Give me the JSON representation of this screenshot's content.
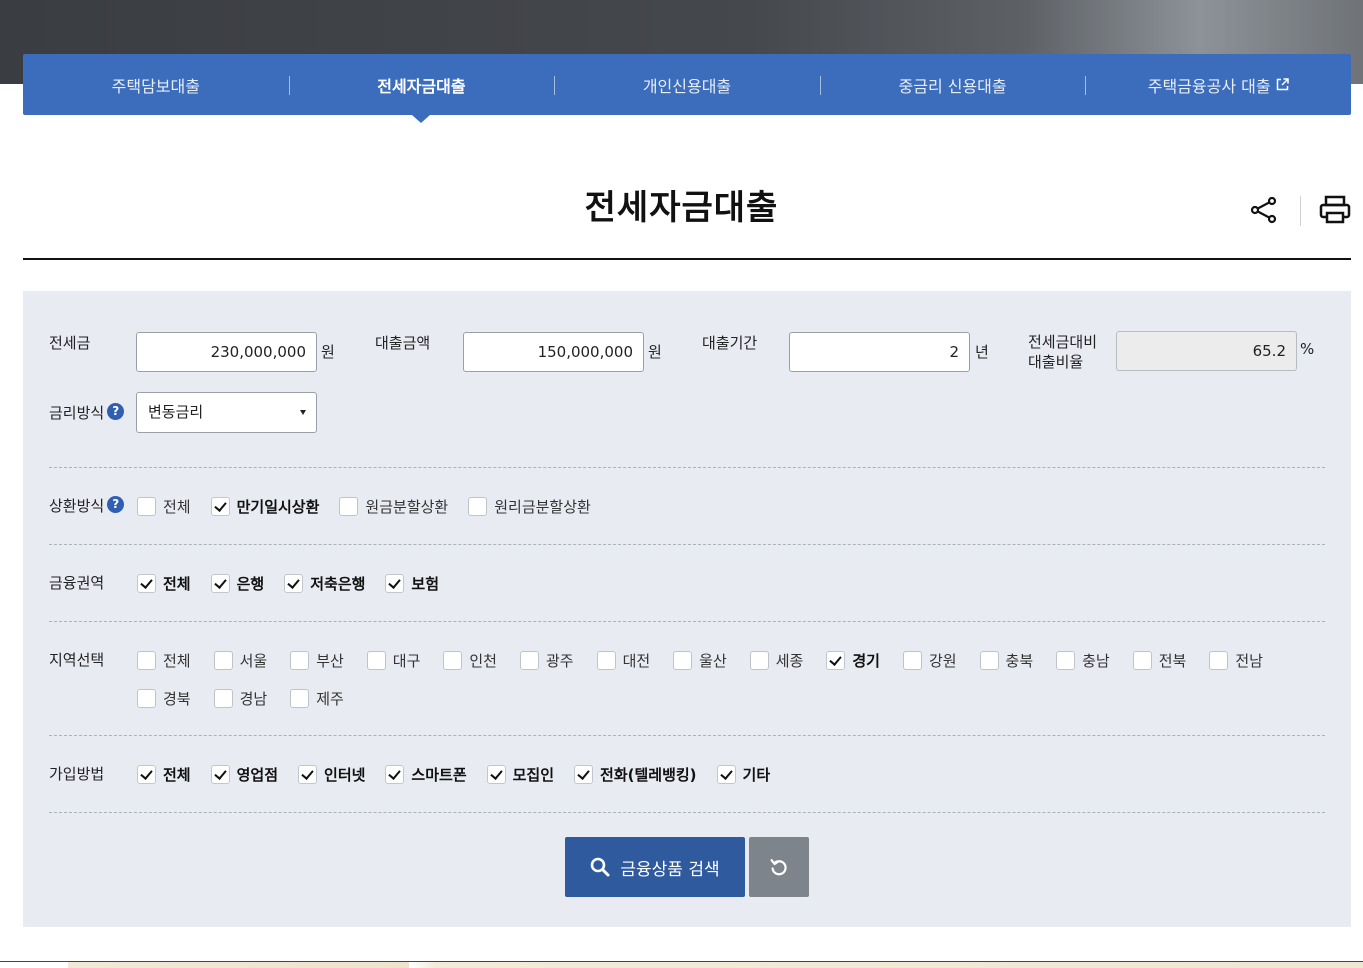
{
  "tabs": [
    {
      "label": "주택담보대출",
      "active": false
    },
    {
      "label": "전세자금대출",
      "active": true
    },
    {
      "label": "개인신용대출",
      "active": false
    },
    {
      "label": "중금리 신용대출",
      "active": false
    },
    {
      "label": "주택금융공사 대출",
      "active": false,
      "external": true
    }
  ],
  "page_title": "전세자금대출",
  "toolbar": {
    "share_icon": "share-icon",
    "print_icon": "print-icon"
  },
  "form": {
    "deposit": {
      "label": "전세금",
      "value": "230,000,000",
      "unit": "원"
    },
    "loan_amount": {
      "label": "대출금액",
      "value": "150,000,000",
      "unit": "원"
    },
    "loan_period": {
      "label": "대출기간",
      "value": "2",
      "unit": "년"
    },
    "ratio": {
      "label_line1": "전세금대비",
      "label_line2": "대출비율",
      "value": "65.2",
      "unit": "%"
    },
    "rate_type": {
      "label": "금리방식",
      "help": "?",
      "selected": "변동금리"
    }
  },
  "repayment": {
    "label": "상환방식",
    "help": "?",
    "options": [
      {
        "label": "전체",
        "checked": false
      },
      {
        "label": "만기일시상환",
        "checked": true
      },
      {
        "label": "원금분할상환",
        "checked": false
      },
      {
        "label": "원리금분할상환",
        "checked": false
      }
    ]
  },
  "sector": {
    "label": "금융권역",
    "options": [
      {
        "label": "전체",
        "checked": true
      },
      {
        "label": "은행",
        "checked": true
      },
      {
        "label": "저축은행",
        "checked": true
      },
      {
        "label": "보험",
        "checked": true
      }
    ]
  },
  "region": {
    "label": "지역선택",
    "options": [
      {
        "label": "전체",
        "checked": false
      },
      {
        "label": "서울",
        "checked": false
      },
      {
        "label": "부산",
        "checked": false
      },
      {
        "label": "대구",
        "checked": false
      },
      {
        "label": "인천",
        "checked": false
      },
      {
        "label": "광주",
        "checked": false
      },
      {
        "label": "대전",
        "checked": false
      },
      {
        "label": "울산",
        "checked": false
      },
      {
        "label": "세종",
        "checked": false
      },
      {
        "label": "경기",
        "checked": true
      },
      {
        "label": "강원",
        "checked": false
      },
      {
        "label": "충북",
        "checked": false
      },
      {
        "label": "충남",
        "checked": false
      },
      {
        "label": "전북",
        "checked": false
      },
      {
        "label": "전남",
        "checked": false
      },
      {
        "label": "경북",
        "checked": false
      },
      {
        "label": "경남",
        "checked": false
      },
      {
        "label": "제주",
        "checked": false
      }
    ]
  },
  "join_method": {
    "label": "가입방법",
    "options": [
      {
        "label": "전체",
        "checked": true
      },
      {
        "label": "영업점",
        "checked": true
      },
      {
        "label": "인터넷",
        "checked": true
      },
      {
        "label": "스마트폰",
        "checked": true
      },
      {
        "label": "모집인",
        "checked": true
      },
      {
        "label": "전화(텔레뱅킹)",
        "checked": true
      },
      {
        "label": "기타",
        "checked": true
      }
    ]
  },
  "buttons": {
    "search_label": "금융상품 검색",
    "search_icon": "search-icon",
    "reset_icon": "refresh-icon"
  },
  "colors": {
    "tab_bar": "#3b6dbc",
    "search_button": "#2f5a9e",
    "reset_button": "#7d848c",
    "panel": "#e8ecf2"
  }
}
